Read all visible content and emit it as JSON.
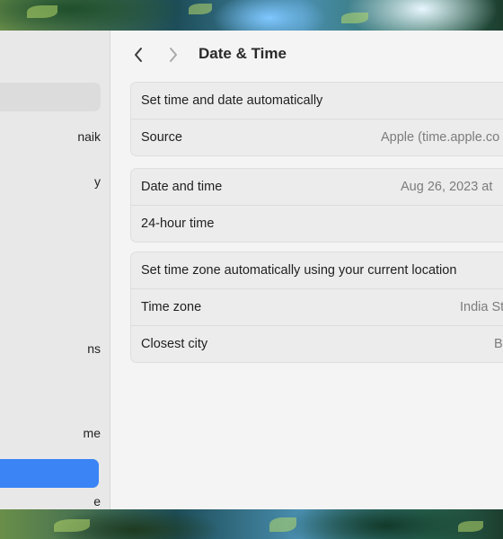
{
  "window": {
    "title": "Date & Time"
  },
  "sidebar": {
    "items": [
      {
        "label": ""
      },
      {
        "label": "naik"
      },
      {
        "label": "y"
      },
      {
        "label": "ns"
      },
      {
        "label": "me"
      },
      {
        "label": ""
      },
      {
        "label": "e"
      }
    ]
  },
  "groups": [
    {
      "rows": [
        {
          "label": "Set time and date automatically",
          "value": ""
        },
        {
          "label": "Source",
          "value": "Apple (time.apple.co"
        }
      ]
    },
    {
      "rows": [
        {
          "label": "Date and time",
          "value": "Aug 26, 2023 at"
        },
        {
          "label": "24-hour time",
          "value": ""
        }
      ]
    },
    {
      "rows": [
        {
          "label": "Set time zone automatically using your current location",
          "value": ""
        },
        {
          "label": "Time zone",
          "value": "India St"
        },
        {
          "label": "Closest city",
          "value": "Ba"
        }
      ]
    }
  ],
  "colors": {
    "accent": "#3b84f5",
    "sidebar_bg": "#e9e8e8",
    "content_bg": "#f4f4f4"
  }
}
